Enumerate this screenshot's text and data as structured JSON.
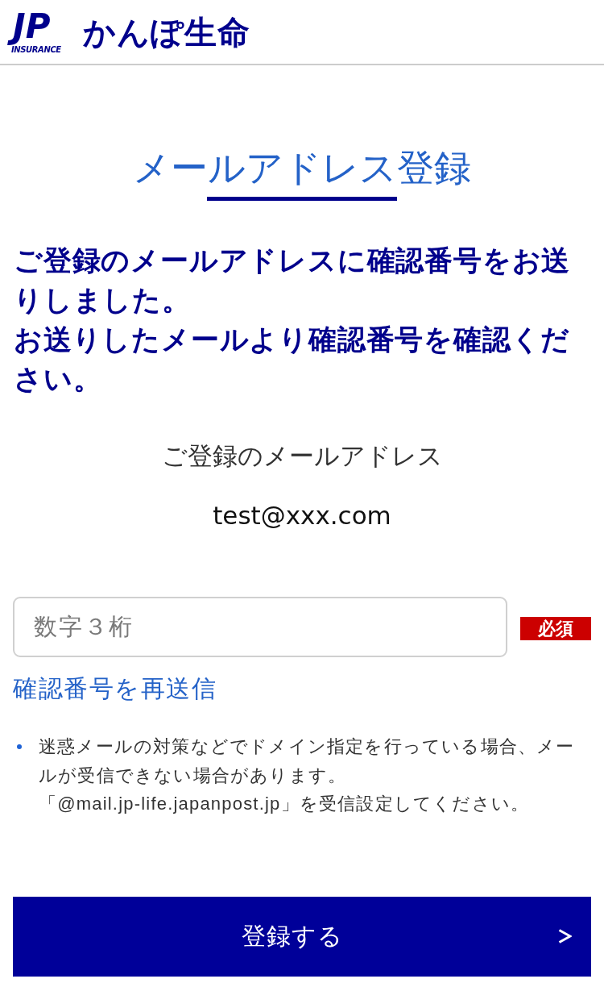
{
  "header": {
    "logo_mark": "JP",
    "logo_subtitle": "INSURANCE",
    "brand": "かんぽ生命"
  },
  "page_title": "メールアドレス登録",
  "message": [
    "ご登録のメールアドレスに確認番号をお送りしました。",
    "お送りしたメールより確認番号を確認ください。"
  ],
  "email_section": {
    "label": "ご登録のメールアドレス",
    "value": "test@xxx.com"
  },
  "code_field": {
    "placeholder": "数字３桁",
    "required_badge": "必須"
  },
  "resend_link": "確認番号を再送信",
  "notes": [
    {
      "lines": [
        "迷惑メールの対策などでドメイン指定を行っている場合、メールが受信できない場合があります。",
        "「@mail.jp-life.japanpost.jp」を受信設定してください。"
      ]
    }
  ],
  "submit_button": {
    "label": "登録する"
  }
}
